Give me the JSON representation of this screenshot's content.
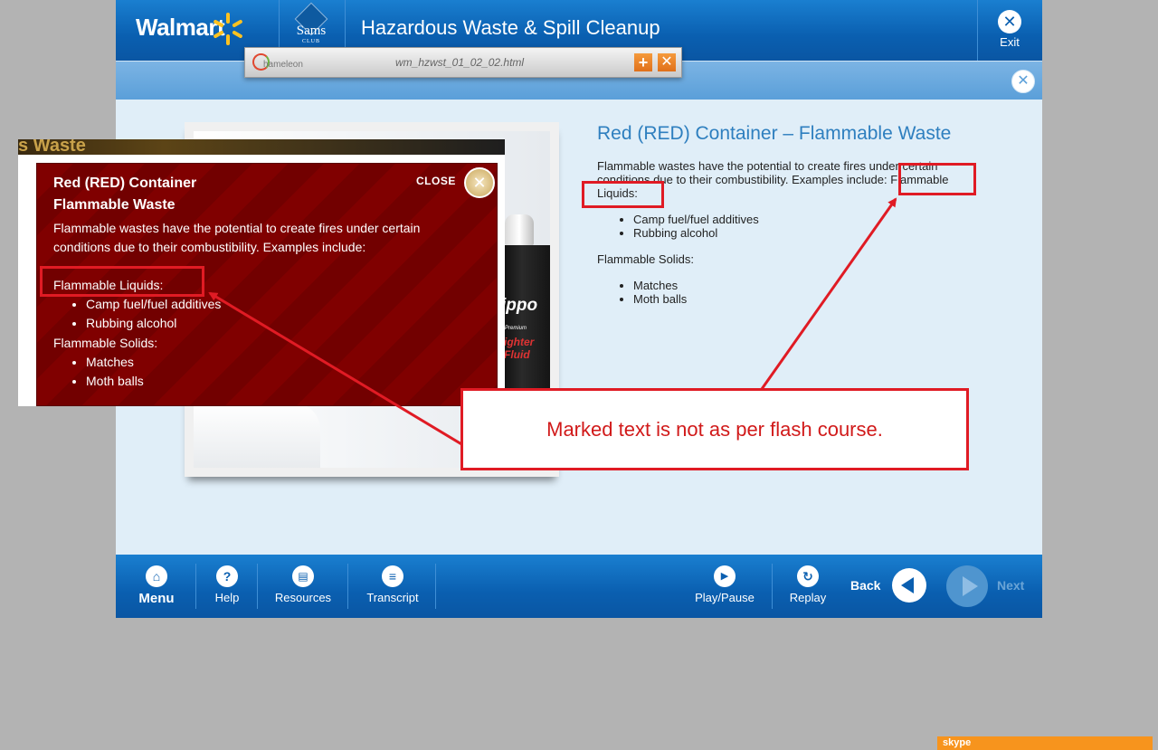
{
  "header": {
    "walmart": "Walmart",
    "sams": "Sams",
    "sams_club": "CLUB",
    "course_title": "Hazardous Waste & Spill Cleanup",
    "exit_label": "Exit"
  },
  "chameleon": {
    "logo_text": "hameleon",
    "filename": "wm_hzwst_01_02_02.html",
    "add_glyph": "+",
    "close_glyph": "✕"
  },
  "panel": {
    "title": "Red (RED) Container – Flammable Waste",
    "intro": "Flammable wastes have the potential to create fires under certain conditions due to their combustibility.  Examples include: Flammable Liquids:",
    "liquids_items": [
      "Camp fuel/fuel additives",
      "Rubbing alcohol"
    ],
    "solids_label": "Flammable Solids:",
    "solids_items": [
      "Matches",
      "Moth balls"
    ]
  },
  "image": {
    "brand": "ippo",
    "sub1": "Premium",
    "sub2": "ighter\nFluid"
  },
  "flash": {
    "top_banner": "s Waste",
    "title_line1": "Red (RED) Container",
    "title_line2": "Flammable Waste",
    "close_label": "CLOSE",
    "intro": "Flammable wastes have the potential to create fires under certain conditions due to their combustibility.  Examples include:",
    "liquids_label": "Flammable Liquids:",
    "liquids_items": [
      "Camp fuel/fuel additives",
      "Rubbing alcohol"
    ],
    "solids_label": "Flammable Solids:",
    "solids_items": [
      "Matches",
      "Moth balls"
    ]
  },
  "annotation": {
    "callout": "Marked text is not as per flash course.",
    "color": "#e01b24"
  },
  "footer": {
    "menu": "Menu",
    "help": "Help",
    "resources": "Resources",
    "transcript": "Transcript",
    "play_pause": "Play/Pause",
    "replay": "Replay",
    "back": "Back",
    "next": "Next"
  },
  "skype": {
    "label": "skype"
  },
  "colors": {
    "brand_blue": "#0a5fb0",
    "content_bg": "#e0eef8",
    "title_blue": "#2e7fbf",
    "flash_red": "#800000"
  }
}
